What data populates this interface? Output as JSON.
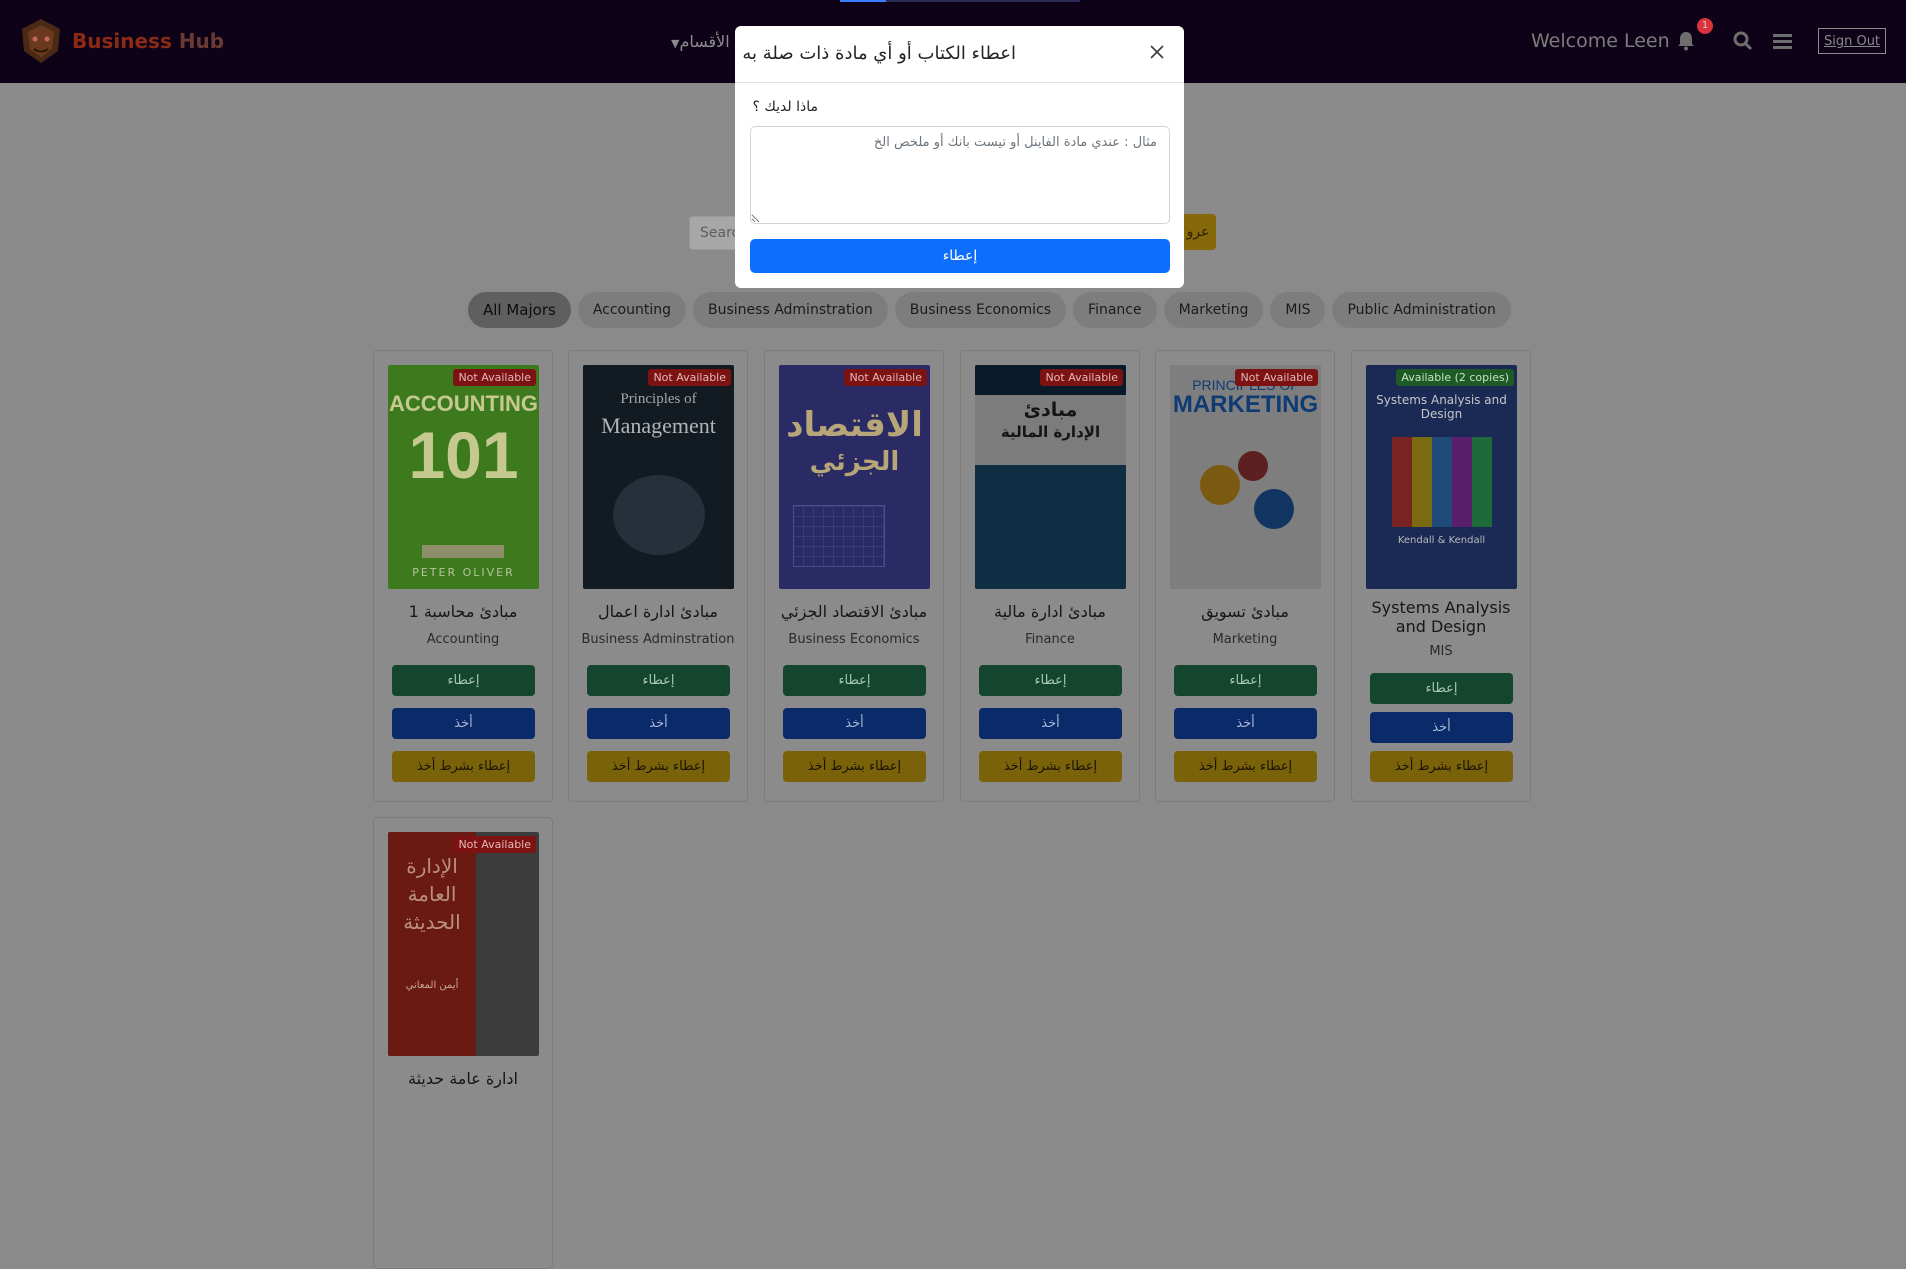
{
  "nav": {
    "brand_first": "Business",
    "brand_second": " Hub",
    "categories_label": "الأقسام",
    "welcome": "Welcome Leen",
    "notification_count": "1",
    "sign_out": "Sign Out"
  },
  "search": {
    "placeholder": "Search",
    "button_label": "عرو"
  },
  "filters": [
    "All Majors",
    "Accounting",
    "Business Adminstration",
    "Business Economics",
    "Finance",
    "Marketing",
    "MIS",
    "Public Administration"
  ],
  "books": [
    {
      "title": "مبادئ محاسبة 1",
      "major": "Accounting",
      "status": "Not Available",
      "cover_title": "ACCOUNTING",
      "cover_sub": "101",
      "cover_footer": "PETER OLIVER"
    },
    {
      "title": "مبادئ ادارة اعمال",
      "major": "Business Adminstration",
      "status": "Not Available",
      "cover_title": "Principles of",
      "cover_sub": "Management"
    },
    {
      "title": "مبادئ الاقتصاد الجزئي",
      "major": "Business Economics",
      "status": "Not Available",
      "cover_title": "الاقتصاد",
      "cover_sub": "الجزئي"
    },
    {
      "title": "مبادئ ادارة مالية",
      "major": "Finance",
      "status": "Not Available",
      "cover_title": "مبادئ",
      "cover_sub": "الإدارة المالية"
    },
    {
      "title": "مبادئ تسويق",
      "major": "Marketing",
      "status": "Not Available",
      "cover_title": "PRINCIPLES OF",
      "cover_sub": "MARKETING"
    },
    {
      "title": "Systems Analysis and Design",
      "major": "MIS",
      "status": "Available (2 copies)",
      "cover_title": "Systems Analysis and Design",
      "cover_sub": "Kendall & Kendall"
    },
    {
      "title": "ادارة عامة حديثة",
      "major": "Public Administration",
      "status": "Not Available",
      "cover_title": "الإدارة العامة الحديثة",
      "cover_sub": "أيمن المعاني"
    }
  ],
  "buttons": {
    "give": "إعطاء",
    "take": "أخذ",
    "give_conditional": "إعطاء بشرط أخذ"
  },
  "modal": {
    "title": "اعطاء الكتاب أو أي مادة ذات صلة به",
    "label": "ماذا لديك ؟",
    "placeholder": "مثال : عندي مادة الفاينل أو تيست بانك أو ملخص الخ",
    "value": "",
    "submit": "إعطاء"
  },
  "colors": {
    "navbar": "#0d0217",
    "primary": "#0d6efd",
    "give": "#198754",
    "take": "#0d47c1",
    "conditional": "#ffc107",
    "not_available": "#dc3545",
    "available": "#28a745"
  }
}
